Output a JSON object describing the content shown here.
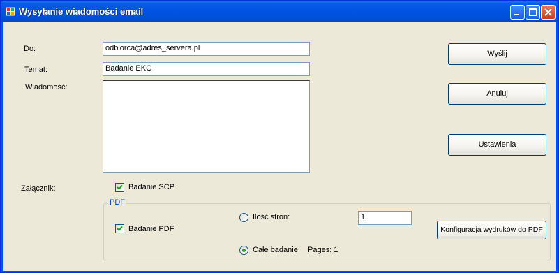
{
  "window": {
    "title": "Wysyłanie wiadomości email"
  },
  "form": {
    "to_label": "Do:",
    "to_value": "odbiorca@adres_servera.pl",
    "subject_label": "Temat:",
    "subject_value": "Badanie EKG",
    "message_label": "Wiadomość:",
    "message_value": "",
    "attachment_label": "Załącznik:",
    "scp_label": "Badanie SCP",
    "scp_checked": true
  },
  "buttons": {
    "send": "Wyślij",
    "cancel": "Anuluj",
    "settings": "Ustawienia",
    "pdf_config": "Konfiguracja wydruków do PDF"
  },
  "pdf_group": {
    "title": "PDF",
    "pdf_label": "Badanie PDF",
    "pdf_checked": true,
    "pages_count_label": "Ilość stron:",
    "pages_count_value": "1",
    "whole_label": "Całe badanie",
    "pages_info": "Pages: 1",
    "selected_option": "whole"
  },
  "colors": {
    "title_bar": "#0054e3",
    "client_bg": "#ece9d8",
    "check_green": "#21a121",
    "group_title": "#0046d5"
  }
}
